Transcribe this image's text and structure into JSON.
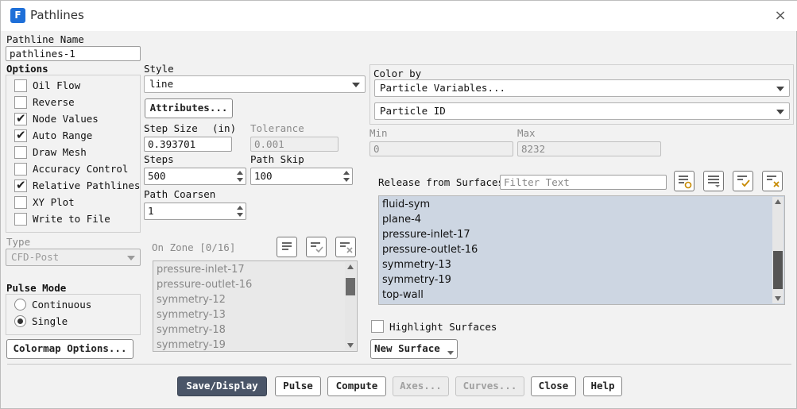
{
  "window": {
    "title": "Pathlines",
    "app_icon": "F",
    "close_icon": "×"
  },
  "pathline_name": {
    "label": "Pathline Name",
    "value": "pathlines-1"
  },
  "options": {
    "label": "Options",
    "items": [
      {
        "label": "Oil Flow",
        "checked": false
      },
      {
        "label": "Reverse",
        "checked": false
      },
      {
        "label": "Node Values",
        "checked": true
      },
      {
        "label": "Auto Range",
        "checked": true
      },
      {
        "label": "Draw Mesh",
        "checked": false
      },
      {
        "label": "Accuracy Control",
        "checked": false
      },
      {
        "label": "Relative Pathlines",
        "checked": true
      },
      {
        "label": "XY Plot",
        "checked": false
      },
      {
        "label": "Write to File",
        "checked": false
      }
    ]
  },
  "type": {
    "label": "Type",
    "value": "CFD-Post"
  },
  "pulse_mode": {
    "label": "Pulse Mode",
    "options": [
      "Continuous",
      "Single"
    ],
    "selected": "Single"
  },
  "colormap_button": "Colormap Options...",
  "style": {
    "label": "Style",
    "value": "line",
    "attributes_button": "Attributes..."
  },
  "step_size": {
    "label": "Step Size",
    "unit": "(in)",
    "value": "0.393701"
  },
  "tolerance": {
    "label": "Tolerance",
    "value": "0.001"
  },
  "steps": {
    "label": "Steps",
    "value": "500"
  },
  "path_skip": {
    "label": "Path Skip",
    "value": "100"
  },
  "path_coarsen": {
    "label": "Path Coarsen",
    "value": "1"
  },
  "on_zone": {
    "label": "On Zone [0/16]",
    "items": [
      "pressure-inlet-17",
      "pressure-outlet-16",
      "symmetry-12",
      "symmetry-13",
      "symmetry-18",
      "symmetry-19"
    ]
  },
  "color_by": {
    "label": "Color by",
    "category": "Particle Variables...",
    "variable": "Particle ID"
  },
  "min": {
    "label": "Min",
    "value": "0"
  },
  "max": {
    "label": "Max",
    "value": "8232"
  },
  "release": {
    "label": "Release from Surfaces",
    "filter_placeholder": "Filter Text",
    "items": [
      "fluid-sym",
      "plane-4",
      "pressure-inlet-17",
      "pressure-outlet-16",
      "symmetry-13",
      "symmetry-19",
      "top-wall"
    ]
  },
  "highlight_surfaces": {
    "label": "Highlight Surfaces",
    "checked": false
  },
  "new_surface_button": "New Surface",
  "footer": {
    "save_display": "Save/Display",
    "pulse": "Pulse",
    "compute": "Compute",
    "axes": "Axes...",
    "curves": "Curves...",
    "close": "Close",
    "help": "Help"
  },
  "colors": {
    "primary_button": "#4a5568",
    "selection": "#cdd6e2",
    "app_icon": "#1e6fd8"
  }
}
